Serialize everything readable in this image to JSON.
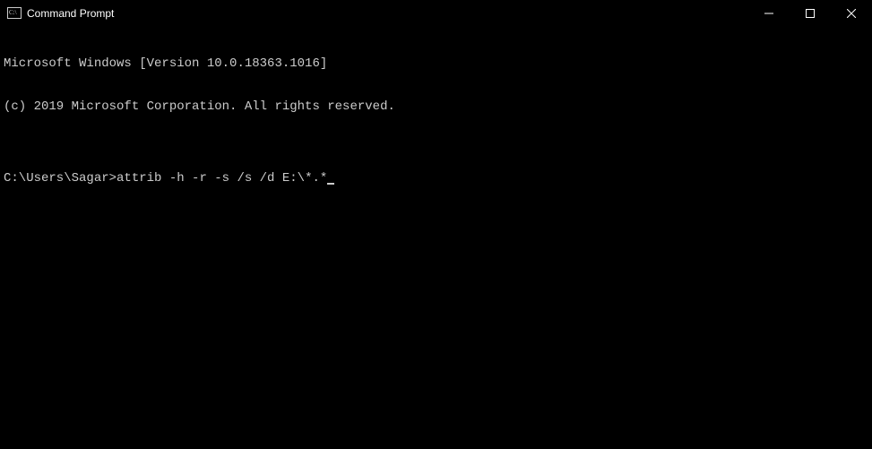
{
  "titlebar": {
    "title": "Command Prompt"
  },
  "terminal": {
    "line1": "Microsoft Windows [Version 10.0.18363.1016]",
    "line2": "(c) 2019 Microsoft Corporation. All rights reserved.",
    "blank": "",
    "prompt": "C:\\Users\\Sagar>",
    "command": "attrib -h -r -s /s /d E:\\*.*"
  }
}
